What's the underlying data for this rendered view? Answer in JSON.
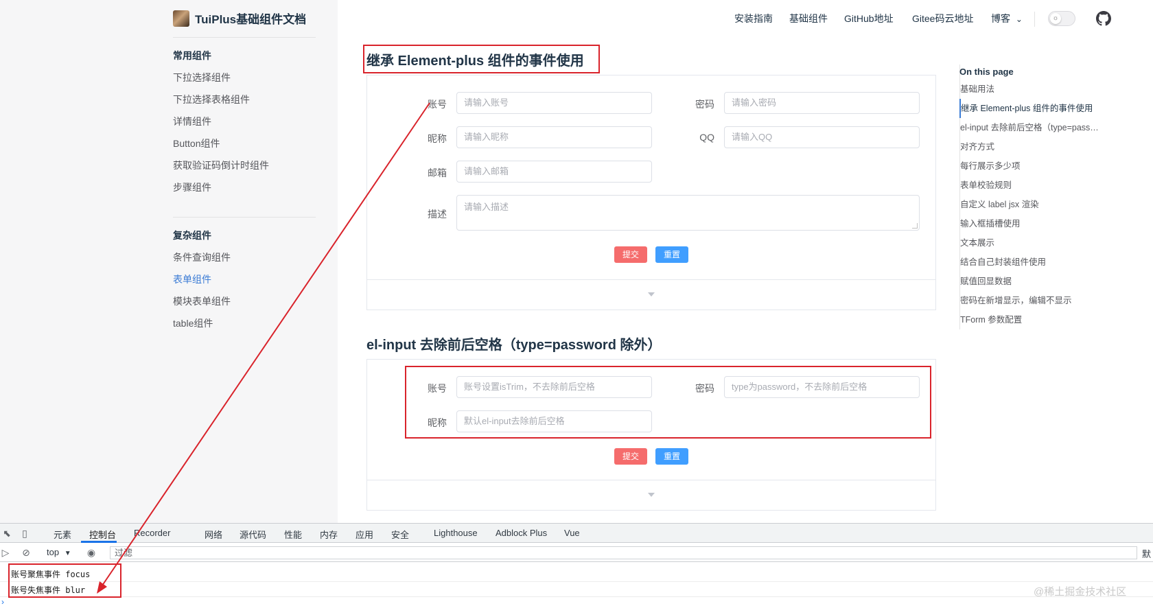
{
  "site": {
    "title": "TuiPlus基础组件文档"
  },
  "sidebar": {
    "groups": [
      {
        "title": "常用组件",
        "items": [
          "下拉选择组件",
          "下拉选择表格组件",
          "详情组件",
          "Button组件",
          "获取验证码倒计时组件",
          "步骤组件"
        ]
      },
      {
        "title": "复杂组件",
        "items": [
          "条件查询组件",
          "表单组件",
          "模块表单组件",
          "table组件"
        ],
        "active_index": 1
      }
    ]
  },
  "nav": {
    "links": [
      "安装指南",
      "基础组件",
      "GitHub地址",
      "Gitee码云地址",
      "博客"
    ],
    "blog_caret": "⌄"
  },
  "sections": [
    {
      "heading": "继承 Element-plus 组件的事件使用",
      "fields": [
        {
          "label": "账号",
          "placeholder": "请输入账号"
        },
        {
          "label": "密码",
          "placeholder": "请输入密码"
        },
        {
          "label": "昵称",
          "placeholder": "请输入昵称"
        },
        {
          "label": "QQ",
          "placeholder": "请输入QQ"
        },
        {
          "label": "邮箱",
          "placeholder": "请输入邮箱"
        },
        {
          "label": "描述",
          "placeholder": "请输入描述"
        }
      ],
      "submit": "提交",
      "reset": "重置"
    },
    {
      "heading": "el-input 去除前后空格（type=password 除外）",
      "fields": [
        {
          "label": "账号",
          "placeholder": "账号设置isTrim，不去除前后空格"
        },
        {
          "label": "密码",
          "placeholder": "type为password，不去除前后空格"
        },
        {
          "label": "昵称",
          "placeholder": "默认el-input去除前后空格"
        }
      ],
      "submit": "提交",
      "reset": "重置"
    }
  ],
  "toc": {
    "title": "On this page",
    "items": [
      "基础用法",
      "继承 Element-plus 组件的事件使用",
      "el-input 去除前后空格（type=pass…",
      "对齐方式",
      "每行展示多少项",
      "表单校验规则",
      "自定义 label jsx 渲染",
      "输入框插槽使用",
      "文本展示",
      "结合自己封装组件使用",
      "赋值回显数据",
      "密码在新增显示，编辑不显示",
      "TForm 参数配置"
    ],
    "active_index": 1
  },
  "devtools": {
    "tabs": [
      "元素",
      "控制台",
      "Recorder",
      "网络",
      "源代码",
      "性能",
      "内存",
      "应用",
      "安全",
      "Lighthouse",
      "Adblock Plus",
      "Vue"
    ],
    "active_tab": "控制台",
    "context": "top",
    "filter_placeholder": "过滤",
    "right_label": "默",
    "console_lines": [
      "账号聚焦事件 focus",
      "账号失焦事件 blur"
    ]
  },
  "watermark": "@稀土掘金技术社区",
  "colors": {
    "accent": "#3a7bd5",
    "danger": "#f56c6c",
    "primary": "#409eff",
    "annotation": "#d9232b"
  }
}
